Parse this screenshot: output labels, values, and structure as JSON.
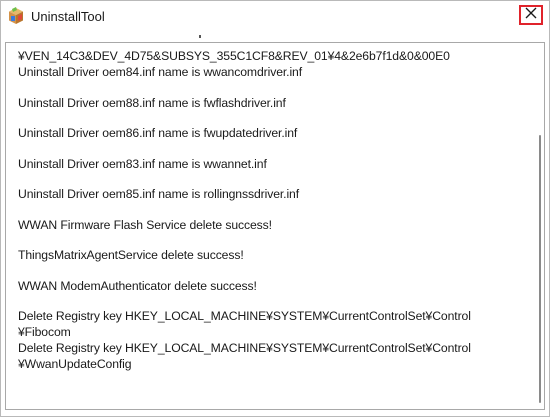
{
  "window": {
    "title": "UninstallTool",
    "icon": "installer-box-icon",
    "close_icon": "close-icon",
    "close_color": "#e0232b"
  },
  "log": {
    "lines": [
      "¥VEN_14C3&DEV_4D75&SUBSYS_355C1CF8&REV_01¥4&2e6b7f1d&0&00E0",
      "Uninstall Driver oem84.inf name is wwancomdriver.inf",
      "",
      "Uninstall Driver oem88.inf name is fwflashdriver.inf",
      "",
      "Uninstall Driver oem86.inf name is fwupdatedriver.inf",
      "",
      "Uninstall Driver oem83.inf name is wwannet.inf",
      "",
      "Uninstall Driver oem85.inf name is rollingnssdriver.inf",
      "",
      "WWAN Firmware Flash Service delete success!",
      "",
      "ThingsMatrixAgentService delete success!",
      "",
      "WWAN ModemAuthenticator delete success!",
      "",
      "Delete Registry key HKEY_LOCAL_MACHINE¥SYSTEM¥CurrentControlSet¥Control",
      "¥Fibocom",
      "Delete Registry key HKEY_LOCAL_MACHINE¥SYSTEM¥CurrentControlSet¥Control",
      "¥WwanUpdateConfig"
    ]
  }
}
